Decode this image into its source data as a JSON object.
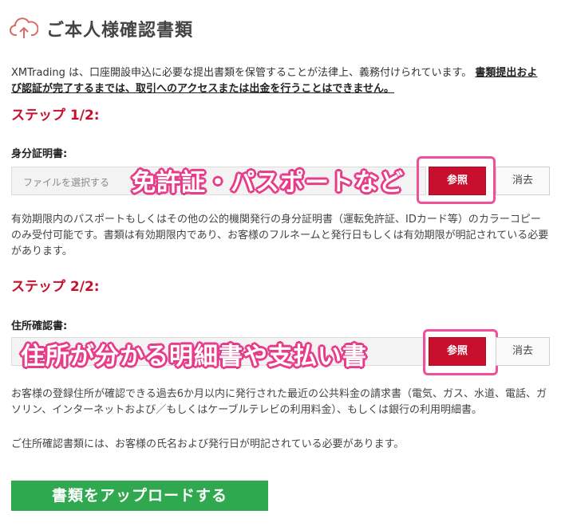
{
  "header": {
    "icon": "cloud-upload-icon",
    "title": "ご本人様確認書類"
  },
  "intro": {
    "text": "XMTrading は、口座開設申込に必要な提出書類を保管することが法律上、義務付けられています。",
    "strong_text": "書類提出および認証が完了するまでは、取引へのアクセスまたは出金を行うことはできません。"
  },
  "step1": {
    "heading": "ステップ 1/2:",
    "field_label": "身分証明書:",
    "file_placeholder": "ファイルを選択する",
    "browse_label": "参照",
    "delete_label": "消去",
    "overlay": "免許証・パスポートなど",
    "note": "有効期限内のパスポートもしくはその他の公的機関発行の身分証明書（運転免許証、IDカード等）のカラーコピーのみ受付可能です。書類は有効期限内であり、お客様のフルネームと発行日もしくは有効期限が明記されている必要があります。"
  },
  "step2": {
    "heading": "ステップ 2/2:",
    "field_label": "住所確認書:",
    "browse_label": "参照",
    "delete_label": "消去",
    "overlay": "住所が分かる明細書や支払い書",
    "note": "お客様の登録住所が確認できる過去6か月以内に発行された最近の公共料金の請求書（電気、ガス、水道、電話、ガソリン、インターネットおよび／もしくはケーブルテレビの利用料金）、もしくは銀行の利用明細書。",
    "note2": "ご住所確認書類には、お客様の氏名および発行日が明記されている必要があります。"
  },
  "upload": {
    "label": "書類をアップロードする"
  },
  "colors": {
    "accent_red": "#c8102e",
    "upload_green": "#2fa84f",
    "annotation_pink": "#f0509a"
  }
}
